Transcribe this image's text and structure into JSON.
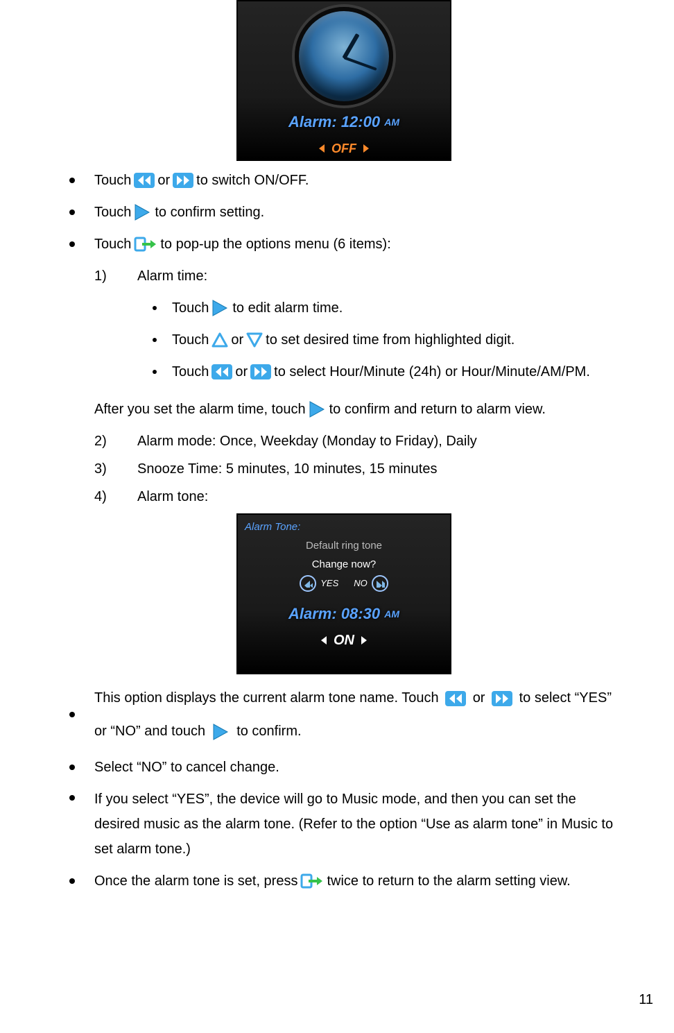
{
  "shot1": {
    "alarm_label_prefix": "Alarm:",
    "alarm_time": "12:00",
    "alarm_ampm": "AM",
    "state": "OFF"
  },
  "b1": {
    "pre": "Touch ",
    "mid": " or ",
    "post": " to switch ON/OFF."
  },
  "b2": {
    "pre": "Touch ",
    "post": "to confirm setting."
  },
  "b3": {
    "pre": "Touch ",
    "post": " to pop-up the options menu (6 items):"
  },
  "opt1": {
    "num": "1)",
    "label": "Alarm time:"
  },
  "opt1a": {
    "pre": "Touch ",
    "post": " to edit alarm time."
  },
  "opt1b": {
    "pre": "Touch ",
    "mid": " or ",
    "post": " to set desired time from highlighted digit."
  },
  "opt1c": {
    "pre": "Touch ",
    "mid": " or ",
    "post": " to select Hour/Minute (24h) or Hour/Minute/AM/PM."
  },
  "after_set": {
    "pre": "After you set the alarm time, touch ",
    "post": " to confirm and return to alarm view."
  },
  "opt2": {
    "num": "2)",
    "text": "Alarm mode: Once, Weekday (Monday to Friday), Daily"
  },
  "opt3": {
    "num": "3)",
    "text": "Snooze Time: 5 minutes, 10 minutes, 15 minutes"
  },
  "opt4": {
    "num": "4)",
    "text": "Alarm tone:"
  },
  "shot2": {
    "dialog_title": "Alarm Tone:",
    "ringtone": "Default ring tone",
    "change_q": "Change now?",
    "yes": "YES",
    "no": "NO",
    "alarm_label_prefix": "Alarm:",
    "alarm_time": "08:30",
    "alarm_ampm": "AM",
    "state": "ON"
  },
  "b4": {
    "pre": "This option displays the current alarm tone name. Touch ",
    "mid": " or ",
    "mid2": " to select “YES” or “NO” and touch ",
    "post": " to confirm."
  },
  "b5": "Select “NO” to cancel change.",
  "b6": "If you select “YES”, the device will go to Music mode, and then you can set the desired music as the alarm tone. (Refer to the option “Use as alarm tone” in Music to set alarm tone.)",
  "b7": {
    "pre": "Once the alarm tone is set, press ",
    "post": " twice to return to the alarm setting view."
  },
  "page_number": "11"
}
